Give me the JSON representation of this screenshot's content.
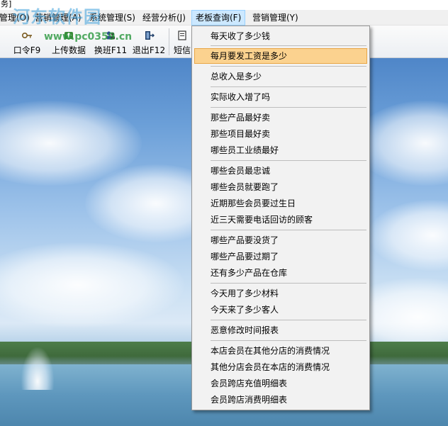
{
  "window": {
    "title_fragment": "务]"
  },
  "menubar": {
    "items": [
      {
        "label": "管理(O)"
      },
      {
        "label": "营销管理(A)"
      },
      {
        "label": "系统管理(S)"
      },
      {
        "label": "经营分析(J)"
      },
      {
        "label": "老板查询(F)"
      },
      {
        "label": "营销管理(Y)"
      }
    ]
  },
  "toolbar": {
    "items": [
      {
        "label": "口令F9",
        "icon": "key-icon"
      },
      {
        "label": "上传数据",
        "icon": "upload-icon"
      },
      {
        "label": "换班F11",
        "icon": "shift-change-icon"
      },
      {
        "label": "退出F12",
        "icon": "exit-icon"
      },
      {
        "label": "短信",
        "icon": "sms-icon"
      }
    ]
  },
  "watermark": {
    "text": "河东软件园",
    "url": "www.pc0359.cn"
  },
  "dropdown": {
    "items": [
      "每天收了多少钱",
      "每月要发工资是多少",
      "总收入是多少",
      "实际收入增了吗",
      "那些产品最好卖",
      "那些项目最好卖",
      "哪些员工业绩最好",
      "哪些会员最忠诚",
      "哪些会员就要跑了",
      "近期那些会员要过生日",
      "近三天需要电话回访的顾客",
      "哪些产品要没货了",
      "哪些产品要过期了",
      "还有多少产品在仓库",
      "今天用了多少材料",
      "今天来了多少客人",
      "恶意修改时间报表",
      "本店会员在其他分店的消费情况",
      "其他分店会员在本店的消费情况",
      "会员跨店充值明细表",
      "会员跨店消费明细表"
    ],
    "highlighted_index": 1
  },
  "colors": {
    "menu_highlight": "#fbd28f",
    "menu_highlight_border": "#e8a646",
    "menubar_active": "#cce8ff",
    "menu_bg": "#f2f2f2"
  }
}
